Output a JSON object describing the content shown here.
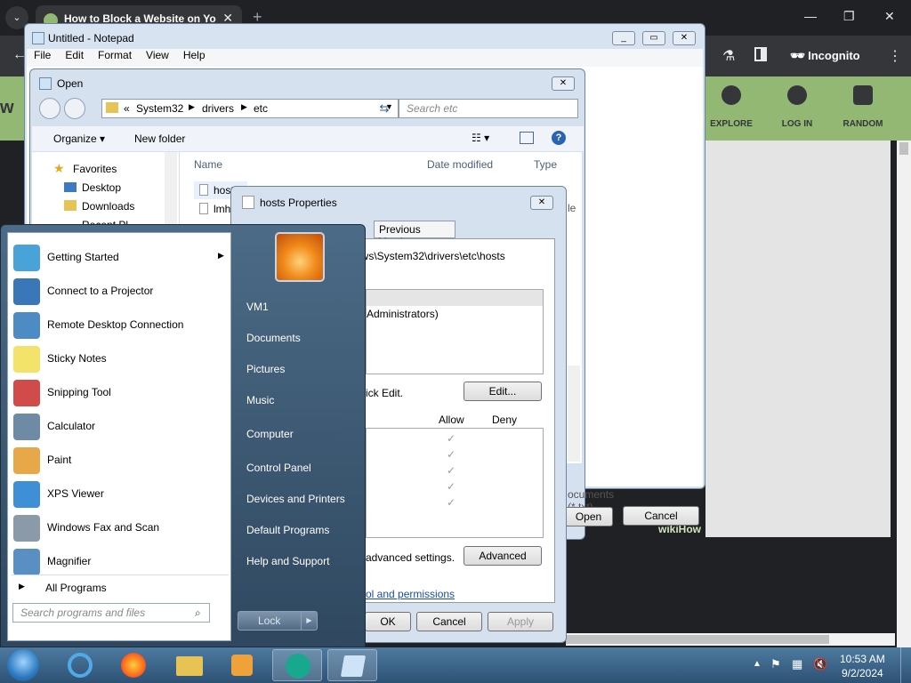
{
  "browser": {
    "tab_title": "How to Block a Website on Yo",
    "incognito_label": "Incognito",
    "wikihow_nav": [
      "EXPLORE",
      "LOG IN",
      "RANDOM"
    ],
    "watermark": "wikiHow"
  },
  "notepad": {
    "title": "Untitled - Notepad",
    "menu": [
      "File",
      "Edit",
      "Format",
      "View",
      "Help"
    ],
    "file_type": "ocuments (*.txt)",
    "open_button": "Open",
    "cancel_button": "Cancel"
  },
  "open_dialog": {
    "title": "Open",
    "path": [
      "System32",
      "drivers",
      "etc"
    ],
    "search_placeholder": "Search etc",
    "organize": "Organize",
    "new_folder": "New folder",
    "nav": [
      "Favorites",
      "Desktop",
      "Downloads",
      "Recent Pl"
    ],
    "columns": [
      "Name",
      "Date modified",
      "Type"
    ],
    "files": [
      "host",
      "lmh"
    ],
    "type_partial": "le"
  },
  "properties": {
    "title": "hosts Properties",
    "tab_previous": "Previous Versions",
    "object_path": "ows\\System32\\drivers\\etc\\hosts",
    "group": "Administrators)",
    "edit_hint": "ick Edit.",
    "edit_button": "Edit...",
    "allow": "Allow",
    "deny": "Deny",
    "advanced_hint": "advanced settings.",
    "advanced_button": "Advanced",
    "link": "ol and permissions",
    "ok": "OK",
    "cancel": "Cancel",
    "apply": "Apply"
  },
  "start_menu": {
    "programs": [
      {
        "label": "Getting Started",
        "icon": "getting-started-icon",
        "color": "#4aa3d8"
      },
      {
        "label": "Connect to a Projector",
        "icon": "projector-icon",
        "color": "#3a77b8"
      },
      {
        "label": "Remote Desktop Connection",
        "icon": "remote-desktop-icon",
        "color": "#4d8bc5"
      },
      {
        "label": "Sticky Notes",
        "icon": "sticky-notes-icon",
        "color": "#f3e36a"
      },
      {
        "label": "Snipping Tool",
        "icon": "snipping-tool-icon",
        "color": "#d24b4b"
      },
      {
        "label": "Calculator",
        "icon": "calculator-icon",
        "color": "#6f8aa5"
      },
      {
        "label": "Paint",
        "icon": "paint-icon",
        "color": "#e7a84a"
      },
      {
        "label": "XPS Viewer",
        "icon": "xps-viewer-icon",
        "color": "#3e8fd6"
      },
      {
        "label": "Windows Fax and Scan",
        "icon": "fax-icon",
        "color": "#8a9aa8"
      },
      {
        "label": "Magnifier",
        "icon": "magnifier-icon",
        "color": "#5a8fc4"
      }
    ],
    "all_programs": "All Programs",
    "search_placeholder": "Search programs and files",
    "right_links": [
      "VM1",
      "Documents",
      "Pictures",
      "Music",
      "Computer",
      "Control Panel",
      "Devices and Printers",
      "Default Programs",
      "Help and Support"
    ],
    "lock": "Lock"
  },
  "taskbar": {
    "time": "10:53 AM",
    "date": "9/2/2024"
  }
}
